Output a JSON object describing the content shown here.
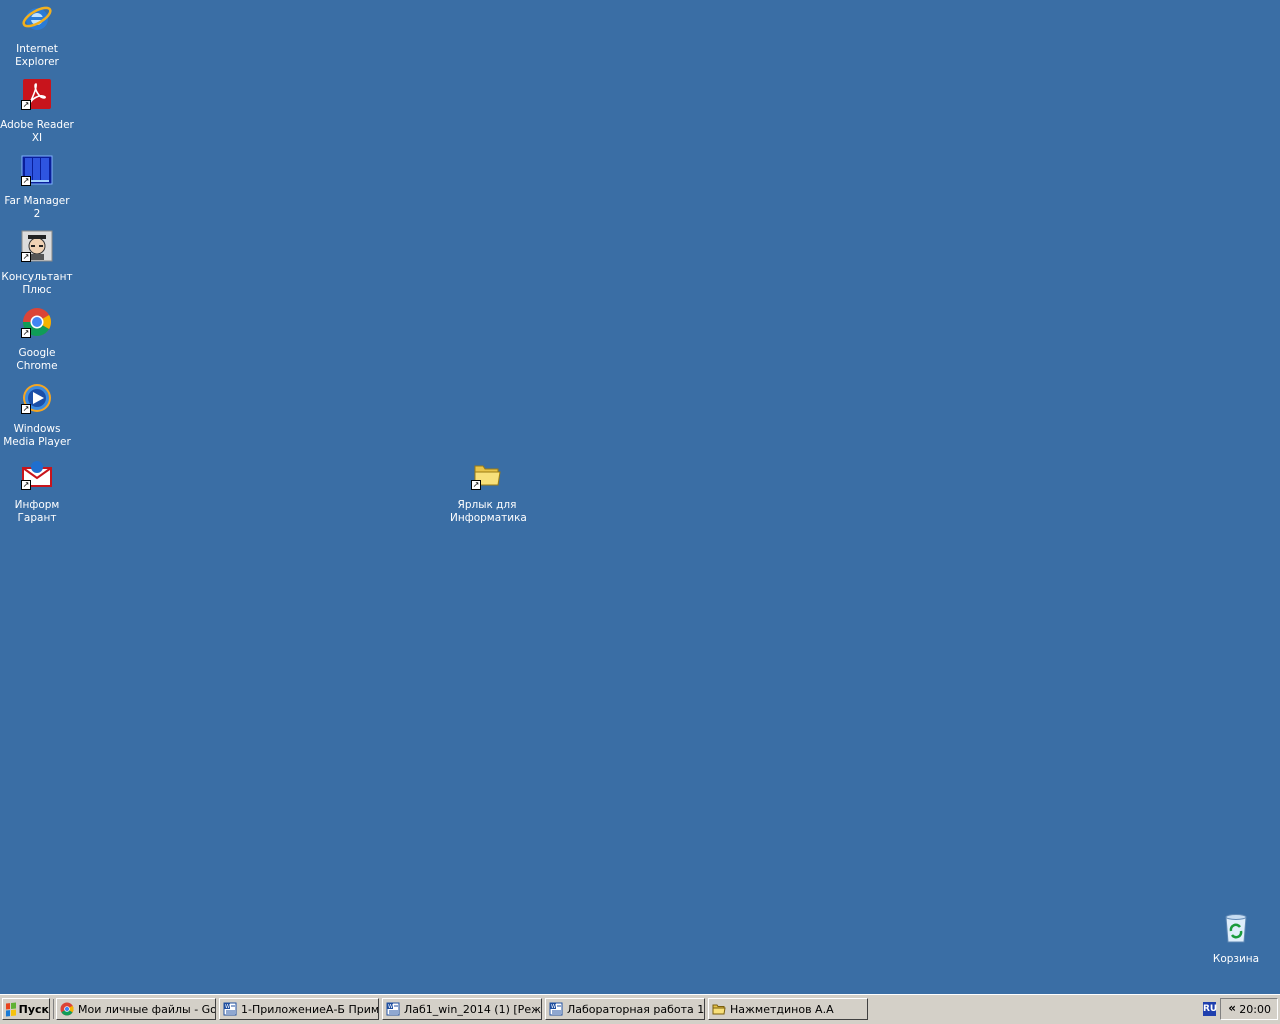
{
  "desktop": {
    "background": "#3a6ea5",
    "icons": [
      {
        "name": "internet-explorer-icon",
        "label": "Internet Explorer",
        "line1": "Internet",
        "line2": "Explorer"
      },
      {
        "name": "adobe-reader-icon",
        "label": "Adobe Reader XI",
        "line1": "Adobe Reader",
        "line2": "XI"
      },
      {
        "name": "far-manager-icon",
        "label": "Far Manager 2",
        "line1": "Far Manager 2",
        "line2": ""
      },
      {
        "name": "consultant-plus-icon",
        "label": "Консультант Плюс",
        "line1": "Консультант",
        "line2": "Плюс"
      },
      {
        "name": "google-chrome-icon",
        "label": "Google Chrome",
        "line1": "Google",
        "line2": "Chrome"
      },
      {
        "name": "windows-media-player-icon",
        "label": "Windows Media Player",
        "line1": "Windows",
        "line2": "Media Player"
      },
      {
        "name": "inform-garant-icon",
        "label": "Информ Гарант",
        "line1": "Информ",
        "line2": "Гарант"
      }
    ],
    "folder_shortcut": {
      "line1": "Ярлык для",
      "line2": "Информатика"
    },
    "recycle_bin": {
      "label": "Корзина"
    }
  },
  "taskbar": {
    "start_label": "Пуск",
    "tasks": [
      {
        "label": "Мои личные файлы - Go...",
        "icon": "chrome-icon"
      },
      {
        "label": "1-ПриложениеА-Б Прим...",
        "icon": "word-doc-icon"
      },
      {
        "label": "Лаб1_win_2014 (1) [Реж...",
        "icon": "word-doc-icon"
      },
      {
        "label": "Лабораторная работа 1...",
        "icon": "word-doc-icon"
      },
      {
        "label": "Нажметдинов А.А",
        "icon": "folder-icon"
      }
    ],
    "tray": {
      "language": "RU",
      "expand_label": "«",
      "clock": "20:00"
    }
  }
}
